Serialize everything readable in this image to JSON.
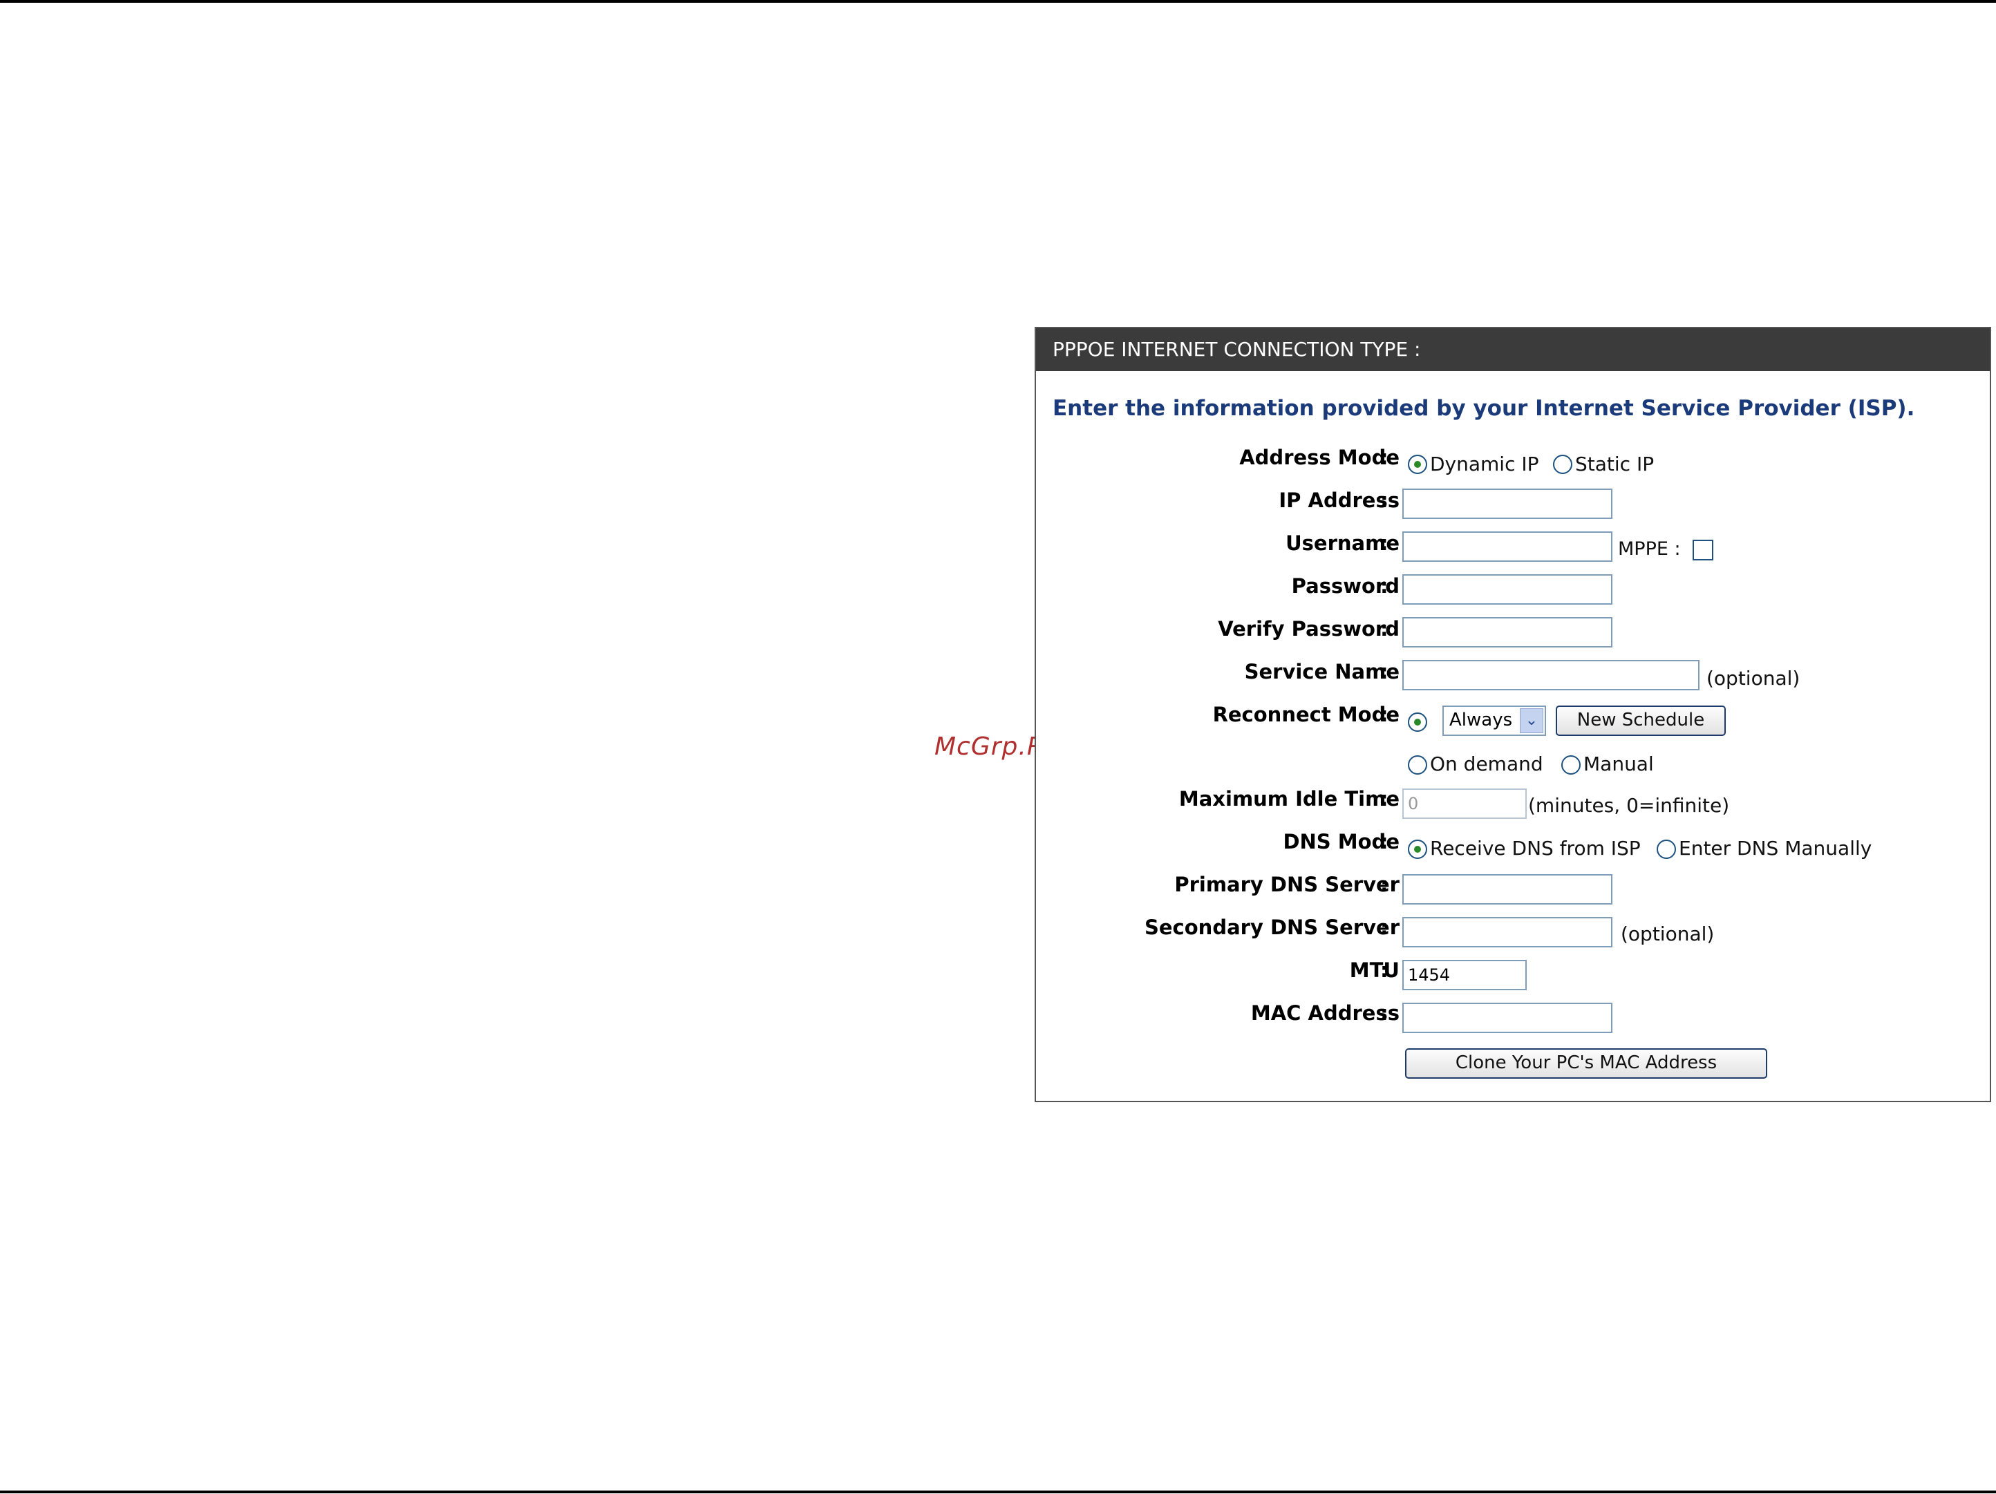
{
  "watermark": "McGrp.Ru",
  "panel": {
    "title": "PPPOE INTERNET CONNECTION TYPE :",
    "intro": "Enter the information provided by your Internet Service Provider (ISP)."
  },
  "form": {
    "colon": ":",
    "address_mode": {
      "label": "Address Mode",
      "options": [
        "Dynamic IP",
        "Static IP"
      ],
      "selected": "Dynamic IP"
    },
    "ip_address": {
      "label": "IP Address",
      "value": ""
    },
    "username": {
      "label": "Username",
      "value": "",
      "mppe_label": "MPPE :",
      "mppe_checked": false
    },
    "password": {
      "label": "Password",
      "value": ""
    },
    "verify_password": {
      "label": "Verify Password",
      "value": ""
    },
    "service_name": {
      "label": "Service Name",
      "value": "",
      "hint": "(optional)"
    },
    "reconnect_mode": {
      "label": "Reconnect Mode",
      "schedule_value": "Always",
      "new_schedule_button": "New Schedule",
      "options": [
        "On demand",
        "Manual"
      ],
      "selected": "Always"
    },
    "max_idle_time": {
      "label": "Maximum Idle Time",
      "value": "0",
      "hint": "(minutes, 0=infinite)"
    },
    "dns_mode": {
      "label": "DNS Mode",
      "options": [
        "Receive DNS from ISP",
        "Enter DNS Manually"
      ],
      "selected": "Receive DNS from ISP"
    },
    "primary_dns": {
      "label": "Primary DNS Server",
      "value": ""
    },
    "secondary_dns": {
      "label": "Secondary DNS Server",
      "value": "",
      "hint": "(optional)"
    },
    "mtu": {
      "label": "MTU",
      "value": "1454"
    },
    "mac_address": {
      "label": "MAC Address",
      "value": ""
    },
    "clone_button": "Clone Your PC's MAC Address"
  }
}
